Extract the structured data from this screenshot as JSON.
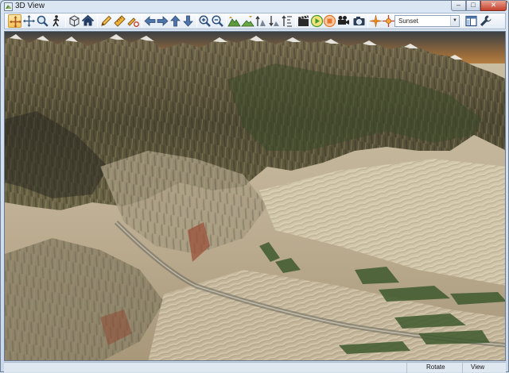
{
  "window": {
    "title": "3D View",
    "minimize_glyph": "–",
    "maximize_glyph": "□",
    "close_glyph": "✕"
  },
  "toolbar": {
    "buttons": [
      {
        "name": "pan-tool-button",
        "icon": "pan-icon",
        "active": true
      },
      {
        "name": "move-tool-button",
        "icon": "move-arrows-icon"
      },
      {
        "name": "zoom-tool-button",
        "icon": "magnifier-icon"
      },
      {
        "name": "fly-tool-button",
        "icon": "walker-icon"
      },
      {
        "name": "cube-view-button",
        "icon": "cube-icon"
      },
      {
        "name": "home-view-button",
        "icon": "home-icon"
      },
      {
        "name": "draw-line-button",
        "icon": "pencil-icon"
      },
      {
        "name": "measure-button",
        "icon": "ruler-icon"
      },
      {
        "name": "profile-button",
        "icon": "profile-tool-icon"
      },
      {
        "name": "nav-left-button",
        "icon": "arrow-left-icon"
      },
      {
        "name": "nav-right-button",
        "icon": "arrow-right-icon"
      },
      {
        "name": "nav-up-button",
        "icon": "arrow-up-icon"
      },
      {
        "name": "nav-down-button",
        "icon": "arrow-down-icon"
      },
      {
        "name": "zoom-in-button",
        "icon": "zoom-in-icon"
      },
      {
        "name": "zoom-out-button",
        "icon": "zoom-out-icon"
      },
      {
        "name": "terrain-raise-button",
        "icon": "terrain-up-icon"
      },
      {
        "name": "terrain-lower-button",
        "icon": "terrain-down-icon"
      },
      {
        "name": "exaggerate-up-button",
        "icon": "exaggerate-up-icon"
      },
      {
        "name": "exaggerate-down-button",
        "icon": "exaggerate-down-icon"
      },
      {
        "name": "vertical-scale-button",
        "icon": "vertical-scale-icon"
      },
      {
        "name": "record-button",
        "icon": "clapperboard-icon"
      },
      {
        "name": "play-button",
        "icon": "play-icon"
      },
      {
        "name": "stop-button",
        "icon": "stop-icon"
      },
      {
        "name": "movie-camera-button",
        "icon": "movie-camera-icon"
      },
      {
        "name": "snapshot-button",
        "icon": "camera-icon"
      },
      {
        "name": "sun-light-button",
        "icon": "sun-star-icon"
      },
      {
        "name": "light-position-button",
        "icon": "light-crosshair-icon"
      },
      {
        "name": "layers-button",
        "icon": "layers-window-icon"
      },
      {
        "name": "settings-button",
        "icon": "wrench-icon"
      }
    ],
    "lighting_preset": "Sunset"
  },
  "status": {
    "mode": "Rotate",
    "view": "View"
  },
  "colors": {
    "accent_active": "#f6c35a",
    "play_green": "#3e9c2e",
    "stop_orange": "#e8762c"
  }
}
